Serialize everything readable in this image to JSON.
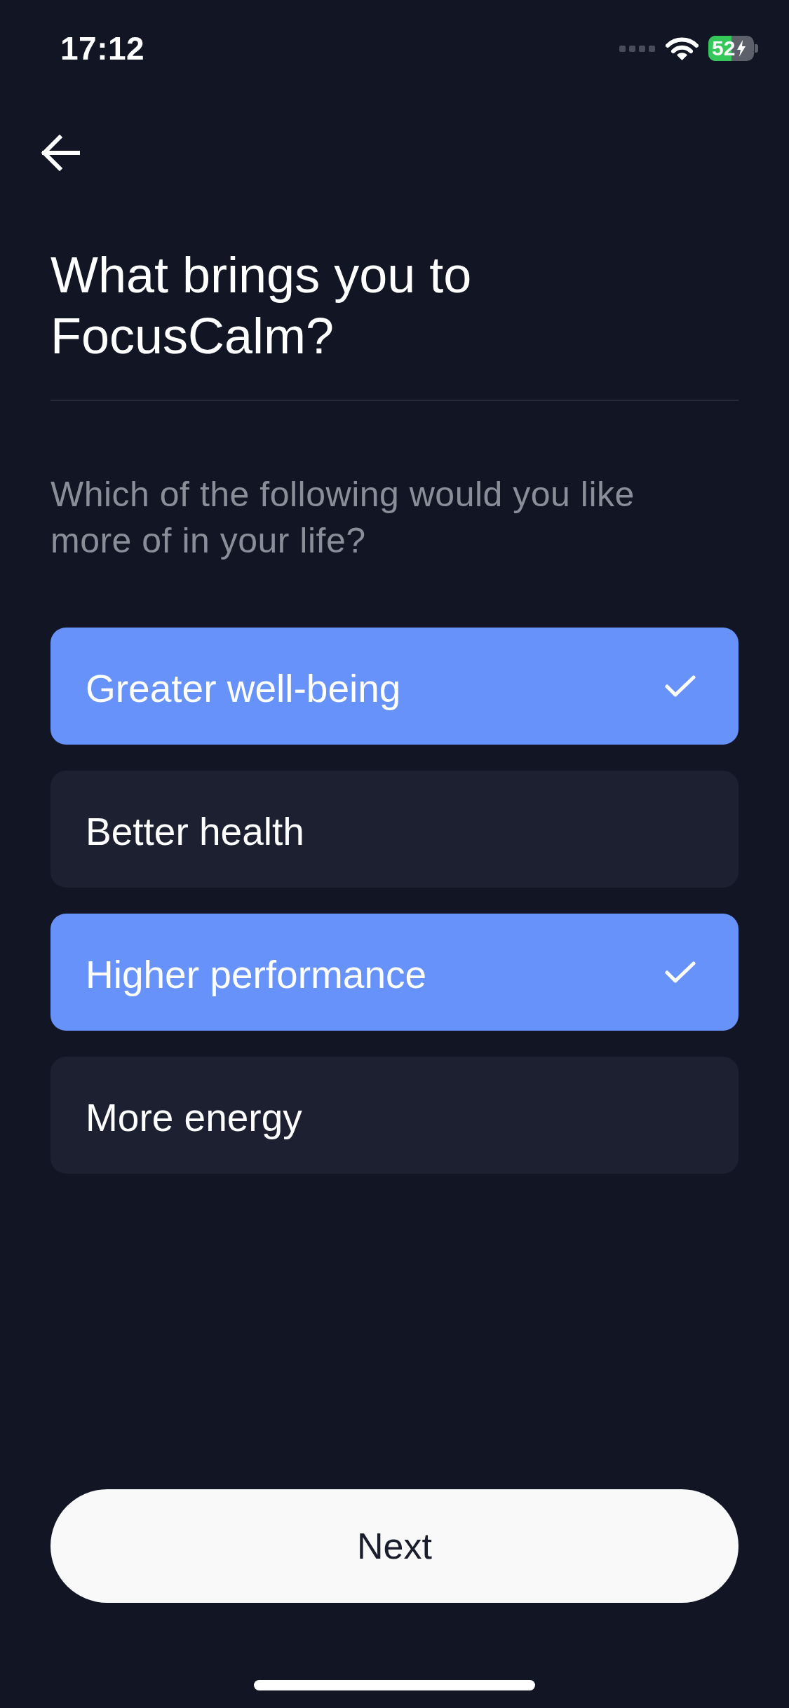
{
  "status_bar": {
    "time": "17:12",
    "battery": "52",
    "charging": true
  },
  "header": {
    "title": "What brings you to FocusCalm?",
    "subtitle": "Which of the following would you like more of in your life?"
  },
  "options": [
    {
      "label": "Greater well-being",
      "selected": true
    },
    {
      "label": "Better health",
      "selected": false
    },
    {
      "label": "Higher performance",
      "selected": true
    },
    {
      "label": "More energy",
      "selected": false
    }
  ],
  "next_button": {
    "label": "Next"
  }
}
